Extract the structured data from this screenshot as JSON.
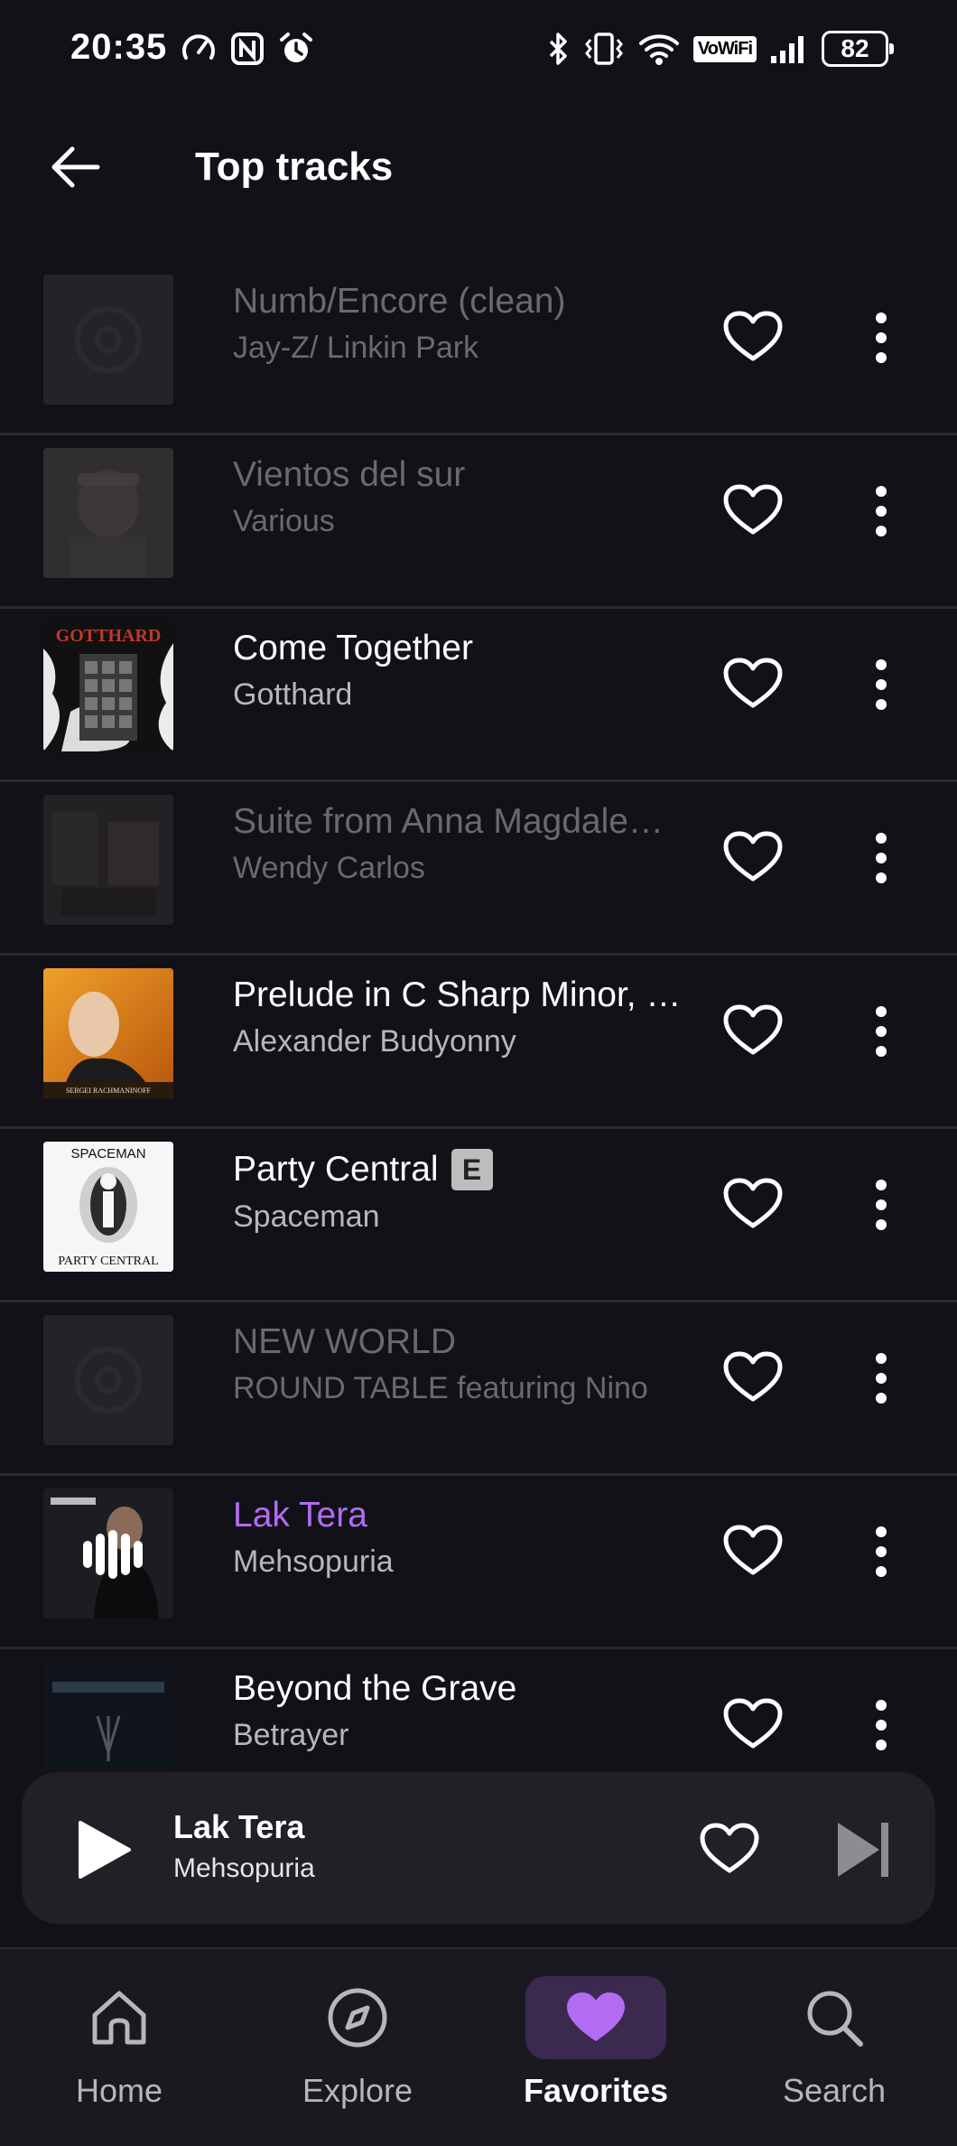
{
  "status_bar": {
    "time": "20:35",
    "vowifi": "VoWiFi",
    "battery": "82"
  },
  "header": {
    "title": "Top tracks",
    "back_icon": "arrow-left-icon"
  },
  "tracks": [
    {
      "title": "Numb/Encore (clean)",
      "artist": "Jay-Z/ Linkin Park",
      "state": "unavailable",
      "explicit": false,
      "art": "placeholder"
    },
    {
      "title": "Vientos del sur",
      "artist": "Various",
      "state": "unavailable",
      "explicit": false,
      "art": "statue"
    },
    {
      "title": "Come Together",
      "artist": "Gotthard",
      "state": "normal",
      "explicit": false,
      "art": "gotthard",
      "art_text": "GOTTHARD"
    },
    {
      "title": "Suite from Anna Magdale…",
      "artist": "Wendy Carlos",
      "state": "unavailable",
      "explicit": false,
      "art": "dark-photo"
    },
    {
      "title": "Prelude in C Sharp Minor, …",
      "artist": "Alexander Budyonny",
      "state": "normal",
      "explicit": false,
      "art": "rachmaninoff",
      "art_text": "SERGEI RACHMANINOFF"
    },
    {
      "title": "Party Central",
      "artist": "Spaceman",
      "state": "normal",
      "explicit": true,
      "explicit_label": "E",
      "art": "spaceman",
      "art_text_top": "SPACEMAN",
      "art_text_bottom": "PARTY CENTRAL"
    },
    {
      "title": "NEW WORLD",
      "artist": "ROUND TABLE featuring Nino",
      "state": "unavailable",
      "explicit": false,
      "art": "placeholder"
    },
    {
      "title": "Lak Tera",
      "artist": "Mehsopuria",
      "state": "playing",
      "explicit": false,
      "art": "mehsopuria"
    },
    {
      "title": "Beyond the Grave",
      "artist": "Betrayer",
      "state": "normal",
      "explicit": false,
      "art": "betrayer"
    }
  ],
  "now_playing": {
    "title": "Lak Tera",
    "artist": "Mehsopuria"
  },
  "bottom_nav": [
    {
      "label": "Home",
      "icon": "home-icon",
      "selected": false
    },
    {
      "label": "Explore",
      "icon": "compass-icon",
      "selected": false
    },
    {
      "label": "Favorites",
      "icon": "heart-filled-icon",
      "selected": true
    },
    {
      "label": "Search",
      "icon": "search-icon",
      "selected": false
    }
  ],
  "colors": {
    "background": "#131118",
    "accent": "#b36bf2",
    "nav_selected_bg": "#3c2950",
    "mini_player_bg": "#221f27"
  }
}
